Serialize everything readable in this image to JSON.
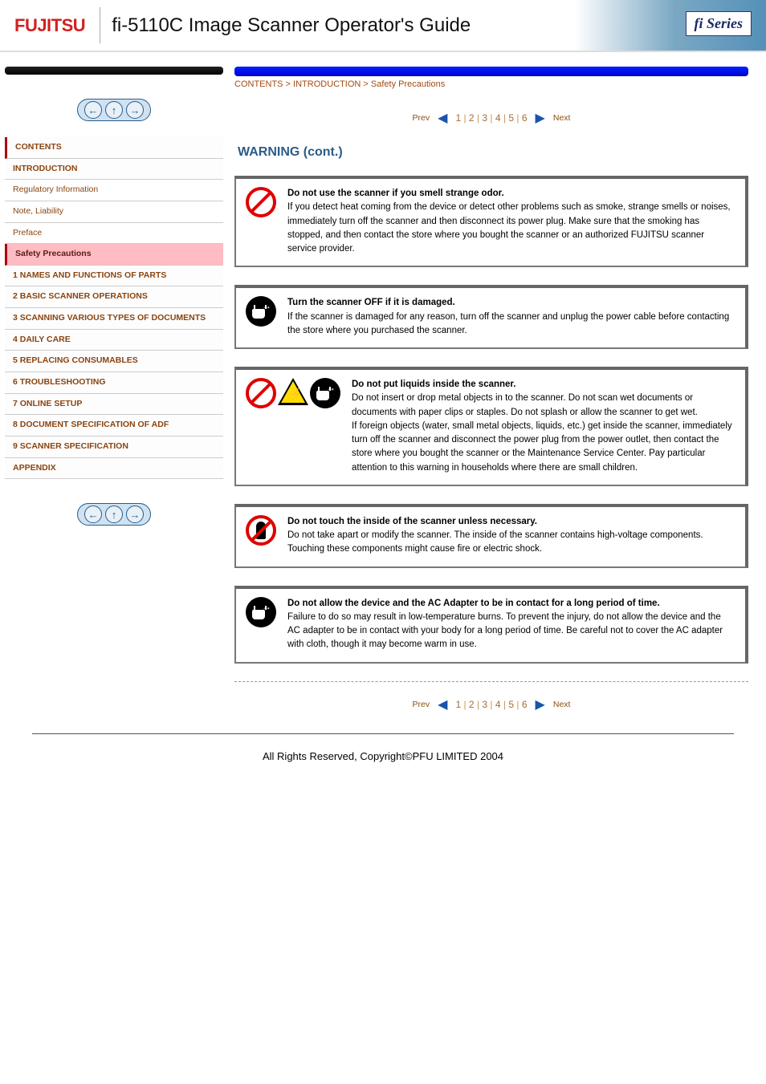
{
  "header": {
    "brand": "FUJITSU",
    "title": "fi-5110C  Image Scanner Operator's Guide",
    "series": "fi Series"
  },
  "sidebar": {
    "items": [
      {
        "text": "CONTENTS",
        "cls": "sec first"
      },
      {
        "text": "INTRODUCTION",
        "cls": "sec"
      },
      {
        "text": "Regulatory Information",
        "cls": ""
      },
      {
        "text": "Note, Liability",
        "cls": ""
      },
      {
        "text": "Preface",
        "cls": ""
      },
      {
        "text": "Safety Precautions",
        "cls": "active"
      },
      {
        "text": "1 NAMES AND FUNCTIONS OF PARTS",
        "cls": "sec"
      },
      {
        "text": "2 BASIC SCANNER OPERATIONS",
        "cls": "sec"
      },
      {
        "text": "3 SCANNING VARIOUS TYPES OF DOCUMENTS",
        "cls": "sec"
      },
      {
        "text": "4 DAILY CARE",
        "cls": "sec"
      },
      {
        "text": "5 REPLACING CONSUMABLES",
        "cls": "sec"
      },
      {
        "text": "6 TROUBLESHOOTING",
        "cls": "sec"
      },
      {
        "text": "7 ONLINE SETUP",
        "cls": "sec"
      },
      {
        "text": "8 DOCUMENT SPECIFICATION OF ADF",
        "cls": "sec"
      },
      {
        "text": "9 SCANNER SPECIFICATION",
        "cls": "sec"
      },
      {
        "text": "APPENDIX",
        "cls": "sec"
      }
    ]
  },
  "breadcrumb": "CONTENTS > INTRODUCTION > Safety Precautions",
  "pager": {
    "prev_label": "Prev",
    "next_label": "Next",
    "pages": [
      "1",
      "2",
      "3",
      "4",
      "5",
      "6"
    ]
  },
  "section_title": "WARNING (cont.)",
  "warnings": [
    {
      "icons": [
        "prohibit"
      ],
      "text": "Do not use the scanner if you smell strange odor.\nIf you detect heat coming from the device or detect other problems such as smoke, strange smells or noises, immediately turn off the scanner and then disconnect its power plug. Make sure that the smoking has stopped, and then contact the store where you bought the scanner or an authorized FUJITSU scanner service provider."
    },
    {
      "icons": [
        "plug"
      ],
      "text": "Turn the scanner OFF if it is damaged.\nIf the scanner is damaged for any reason, turn off the scanner and unplug the power cable before contacting the store where you purchased the scanner."
    },
    {
      "icons": [
        "prohibit",
        "shock",
        "plug"
      ],
      "text": "Do not put liquids inside the scanner.\nDo not insert or drop metal objects in to the scanner. Do not scan wet documents or documents with paper clips or staples. Do not splash or allow the scanner to get wet.\nIf foreign objects (water, small metal objects, liquids, etc.) get inside the scanner, immediately turn off the scanner and disconnect the power plug from the power outlet, then contact the store where you bought the scanner or the Maintenance Service Center. Pay particular attention to this warning in households where there are small children."
    },
    {
      "icons": [
        "notouch"
      ],
      "text": "Do not touch the inside of the scanner unless necessary.\nDo not take apart or modify the scanner. The inside of the scanner contains high-voltage components. Touching these components might cause fire or electric shock."
    },
    {
      "icons": [
        "plug"
      ],
      "text": "Do not allow the device and the AC Adapter to be in contact for a long period of time.\nFailure to do so may result in low-temperature burns. To prevent the injury, do not allow the device and the AC adapter to be in contact with your body for a long period of time. Be careful not to cover the AC adapter with cloth, though it may become warm in use."
    }
  ],
  "footer": "All Rights Reserved,  Copyright©PFU LIMITED 2004"
}
